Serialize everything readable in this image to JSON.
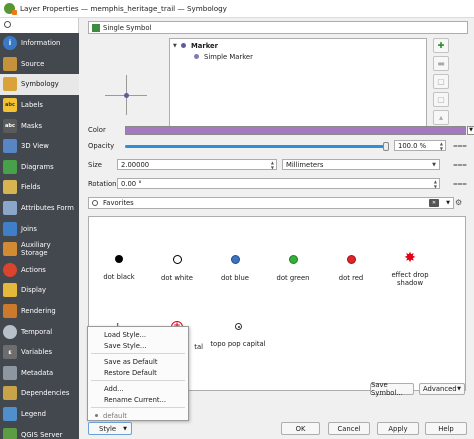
{
  "window": {
    "title": "Layer Properties — memphis_heritage_trail — Symbology"
  },
  "sidebar": {
    "items": [
      {
        "label": "Information",
        "icon": "info-icon",
        "color": "#3a78c6"
      },
      {
        "label": "Source",
        "icon": "source-icon",
        "color": "#c5913b"
      },
      {
        "label": "Symbology",
        "icon": "symbology-icon",
        "color": "#d9a23a"
      },
      {
        "label": "Labels",
        "icon": "labels-icon",
        "color": "#f2c232"
      },
      {
        "label": "Masks",
        "icon": "masks-icon",
        "color": "#5a5a5a"
      },
      {
        "label": "3D View",
        "icon": "3d-view-icon",
        "color": "#5885c4"
      },
      {
        "label": "Diagrams",
        "icon": "diagrams-icon",
        "color": "#49a04a"
      },
      {
        "label": "Fields",
        "icon": "fields-icon",
        "color": "#d6b451"
      },
      {
        "label": "Attributes Form",
        "icon": "attributes-form-icon",
        "color": "#8aa6c8"
      },
      {
        "label": "Joins",
        "icon": "joins-icon",
        "color": "#3e7fc7"
      },
      {
        "label": "Auxiliary Storage",
        "icon": "auxiliary-storage-icon",
        "color": "#d28b33"
      },
      {
        "label": "Actions",
        "icon": "actions-icon",
        "color": "#d9442e"
      },
      {
        "label": "Display",
        "icon": "display-icon",
        "color": "#e4b83a"
      },
      {
        "label": "Rendering",
        "icon": "rendering-icon",
        "color": "#ca7a2a"
      },
      {
        "label": "Temporal",
        "icon": "temporal-icon",
        "color": "#b7bfc9"
      },
      {
        "label": "Variables",
        "icon": "variables-icon",
        "color": "#6d6d6d"
      },
      {
        "label": "Metadata",
        "icon": "metadata-icon",
        "color": "#8e96a0"
      },
      {
        "label": "Dependencies",
        "icon": "dependencies-icon",
        "color": "#c9a34a"
      },
      {
        "label": "Legend",
        "icon": "legend-icon",
        "color": "#4f8fcb"
      },
      {
        "label": "QGIS Server",
        "icon": "qgis-server-icon",
        "color": "#5c9c45"
      }
    ],
    "active_index": 2
  },
  "symbology": {
    "renderer": "Single Symbol",
    "tree": {
      "root": "Marker",
      "child": "Simple Marker"
    }
  },
  "props": {
    "color_label": "Color",
    "color_value": "#a479c0",
    "opacity_label": "Opacity",
    "opacity_value": "100.0 %",
    "opacity_fraction": 1.0,
    "size_label": "Size",
    "size_value": "2.00000",
    "size_unit": "Millimeters",
    "rotation_label": "Rotation",
    "rotation_value": "0.00 °"
  },
  "library": {
    "filter": "Favorites",
    "symbols": [
      {
        "label": "dot  black",
        "kind": "black"
      },
      {
        "label": "dot  white",
        "kind": "white"
      },
      {
        "label": "dot blue",
        "kind": "blue"
      },
      {
        "label": "dot green",
        "kind": "green"
      },
      {
        "label": "dot red",
        "kind": "red"
      },
      {
        "label": "effect drop shadow",
        "kind": "star"
      },
      {
        "label": "",
        "kind": "wheel"
      },
      {
        "label": "tal",
        "kind": "hospital"
      },
      {
        "label": "topo pop capital",
        "kind": "topo"
      }
    ]
  },
  "buttons": {
    "save_symbol": "Save Symbol...",
    "advanced": "Advanced",
    "style": "Style",
    "ok": "OK",
    "cancel": "Cancel",
    "apply": "Apply",
    "help": "Help"
  },
  "style_menu": {
    "items": [
      "Load Style...",
      "Save Style...",
      "Save as Default",
      "Restore Default",
      "Add...",
      "Rename Current..."
    ],
    "current": "default"
  }
}
